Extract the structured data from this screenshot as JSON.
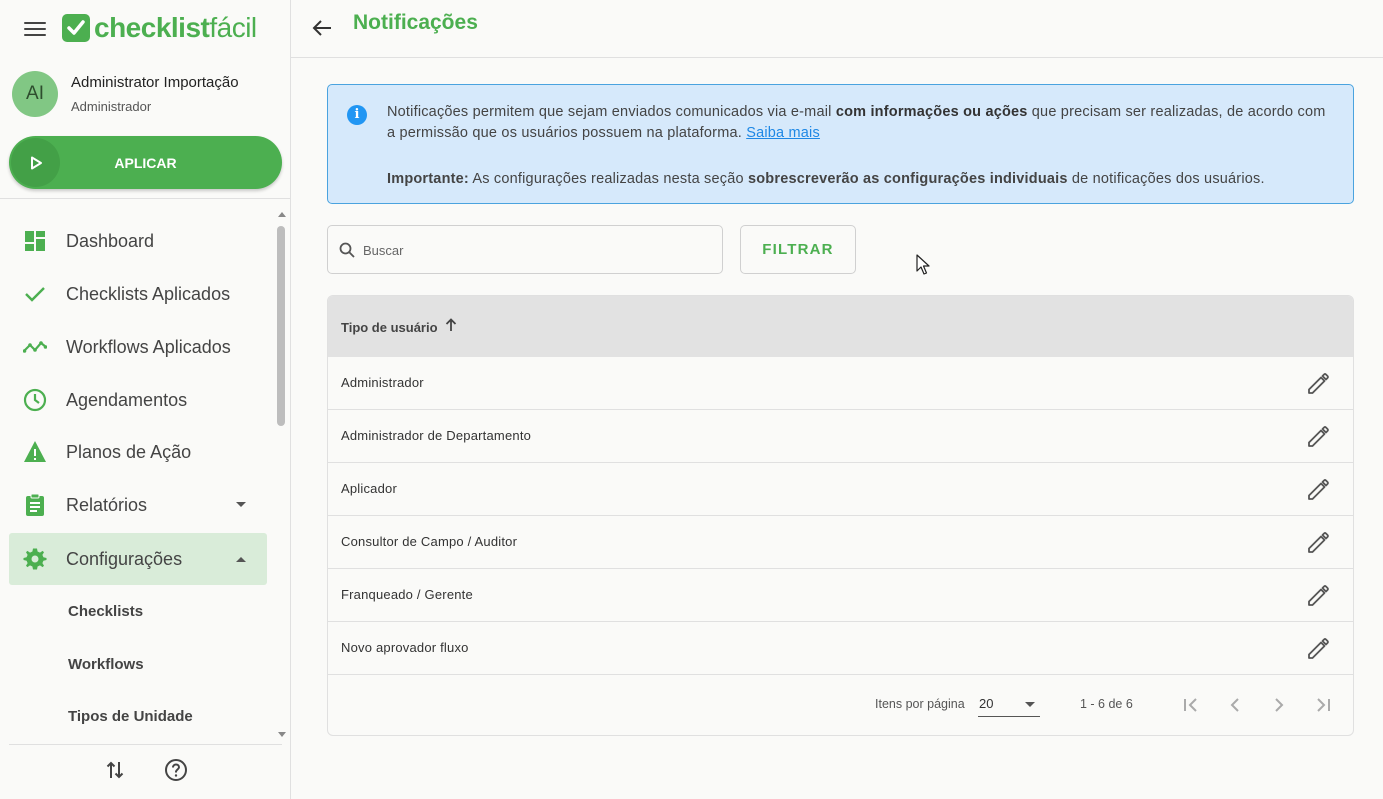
{
  "app": {
    "logo_bold": "checklist",
    "logo_light": "fácil"
  },
  "user": {
    "initials": "AI",
    "name": "Administrator Importação",
    "role": "Administrador"
  },
  "sidebar": {
    "apply_label": "APLICAR",
    "items": [
      {
        "label": "Dashboard",
        "icon": "dashboard-icon"
      },
      {
        "label": "Checklists Aplicados",
        "icon": "check-icon"
      },
      {
        "label": "Workflows Aplicados",
        "icon": "timeline-icon"
      },
      {
        "label": "Agendamentos",
        "icon": "clock-icon"
      },
      {
        "label": "Planos de Ação",
        "icon": "warning-icon"
      },
      {
        "label": "Relatórios",
        "icon": "clipboard-icon"
      },
      {
        "label": "Configurações",
        "icon": "gear-icon"
      }
    ],
    "subitems": [
      "Checklists",
      "Workflows",
      "Tipos de Unidade"
    ]
  },
  "header": {
    "title": "Notificações"
  },
  "info": {
    "p1_a": "Notificações permitem que sejam enviados comunicados via e-mail ",
    "p1_b": "com informações ou ações",
    "p1_c": " que precisam ser realizadas, de acordo com a permissão que os usuários possuem na plataforma. ",
    "p1_link": "Saiba mais",
    "p2_a": "Importante:",
    "p2_b": " As configurações realizadas nesta seção ",
    "p2_c": "sobrescreverão as configurações individuais",
    "p2_d": " de notificações dos usuários."
  },
  "search": {
    "placeholder": "Buscar"
  },
  "filter_label": "FILTRAR",
  "table": {
    "column_header": "Tipo de usuário",
    "rows": [
      "Administrador",
      "Administrador de Departamento",
      "Aplicador",
      "Consultor de Campo / Auditor",
      "Franqueado / Gerente",
      "Novo aprovador fluxo"
    ]
  },
  "pagination": {
    "items_per_page_label": "Itens por página",
    "items_per_page_value": "20",
    "range": "1 - 6 de 6"
  },
  "colors": {
    "brand_green": "#4caf50",
    "info_bg": "#d6e9fb",
    "info_border": "#4aa3df",
    "active_nav_bg": "#d9ecd9"
  }
}
